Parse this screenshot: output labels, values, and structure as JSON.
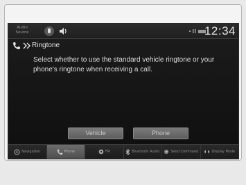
{
  "status_bar": {
    "audio_source_label_line1": "Audio",
    "audio_source_label_line2": "Source",
    "clock": "12:34",
    "mic_icon": "microphone-icon",
    "speaker_icon": "speaker-icon"
  },
  "header": {
    "title": "Ringtone"
  },
  "message": "Select whether to use the standard vehicle ringtone or your phone's ringtone when receiving a call.",
  "buttons": {
    "vehicle": "Vehicle",
    "phone": "Phone"
  },
  "bottom_nav": {
    "items": [
      {
        "label": "Navigation",
        "icon": "navigation-icon"
      },
      {
        "label": "Phone",
        "icon": "phone-icon",
        "active": true
      },
      {
        "label": "FM",
        "icon": "radio-icon"
      },
      {
        "label": "Bluetooth Audio",
        "icon": "bluetooth-icon"
      },
      {
        "label": "Send Command",
        "icon": "send-icon"
      },
      {
        "label": "Display Mode",
        "icon": "display-icon"
      }
    ]
  },
  "colors": {
    "screen_bg": "#161616",
    "text": "#dcdcdc",
    "button": "#6a6a6a",
    "active_tab": "#5e5e5e"
  }
}
